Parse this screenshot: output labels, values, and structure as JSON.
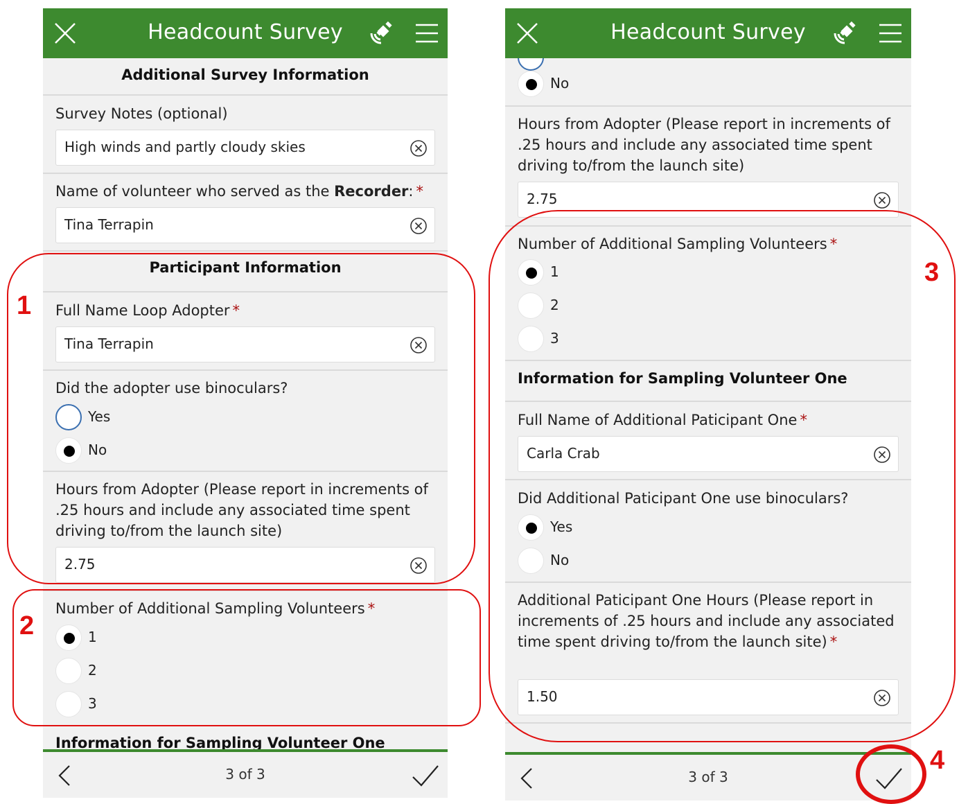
{
  "app": {
    "title": "Headcount Survey"
  },
  "left": {
    "section_title": "Additional Survey Information",
    "notes": {
      "label": "Survey Notes (optional)",
      "value": "High winds and partly cloudy skies"
    },
    "recorder": {
      "label_pre": "Name of volunteer who served as the ",
      "label_bold": "Recorder",
      "label_post": ":",
      "required": "*",
      "value": "Tina Terrapin"
    },
    "participant_title": "Participant Information",
    "adopter_name": {
      "label": "Full Name Loop Adopter",
      "required": "*",
      "value": "Tina Terrapin"
    },
    "binoculars": {
      "label": "Did the adopter use binoculars?",
      "options": [
        "Yes",
        "No"
      ],
      "selected": "No"
    },
    "hours": {
      "label": "Hours from Adopter (Please report in increments of .25 hours and include any associated time spent driving to/from the launch site)",
      "value": "2.75"
    },
    "volunteers": {
      "label": "Number of Additional Sampling Volunteers",
      "required": "*",
      "options": [
        "1",
        "2",
        "3"
      ],
      "selected": "1"
    },
    "next_section_partial": "Information for Sampling Volunteer One",
    "footer": {
      "page": "3 of 3"
    }
  },
  "right": {
    "binoculars_no": "No",
    "hours": {
      "label": "Hours from Adopter (Please report in increments of .25 hours and include any associated time spent driving to/from the launch site)",
      "value": "2.75"
    },
    "volunteers": {
      "label": "Number of Additional Sampling Volunteers",
      "required": "*",
      "options": [
        "1",
        "2",
        "3"
      ],
      "selected": "1"
    },
    "volunteer_one_title": "Information for Sampling Volunteer One",
    "participant_one_name": {
      "label": "Full Name of Additional Paticipant One",
      "required": "*",
      "value": "Carla Crab"
    },
    "participant_one_binoculars": {
      "label": "Did Additional Paticipant One use binoculars?",
      "options": [
        "Yes",
        "No"
      ],
      "selected": "Yes"
    },
    "participant_one_hours": {
      "label": "Additional Paticipant One Hours (Please report in increments of .25 hours and include any associated time spent driving to/from the launch site)",
      "required": "*",
      "value": "1.50"
    },
    "footer": {
      "page": "3 of 3"
    }
  },
  "annotations": {
    "one": "1",
    "two": "2",
    "three": "3",
    "four": "4"
  },
  "colors": {
    "header_green": "#3d8a2f",
    "annotation_red": "#e01010",
    "required_red": "#aa1111"
  },
  "icons": {
    "close": "close-icon",
    "gps": "gps-satellite-icon",
    "menu": "hamburger-menu-icon",
    "clear": "clear-circle-icon",
    "back": "chevron-left-icon",
    "submit": "checkmark-icon"
  }
}
